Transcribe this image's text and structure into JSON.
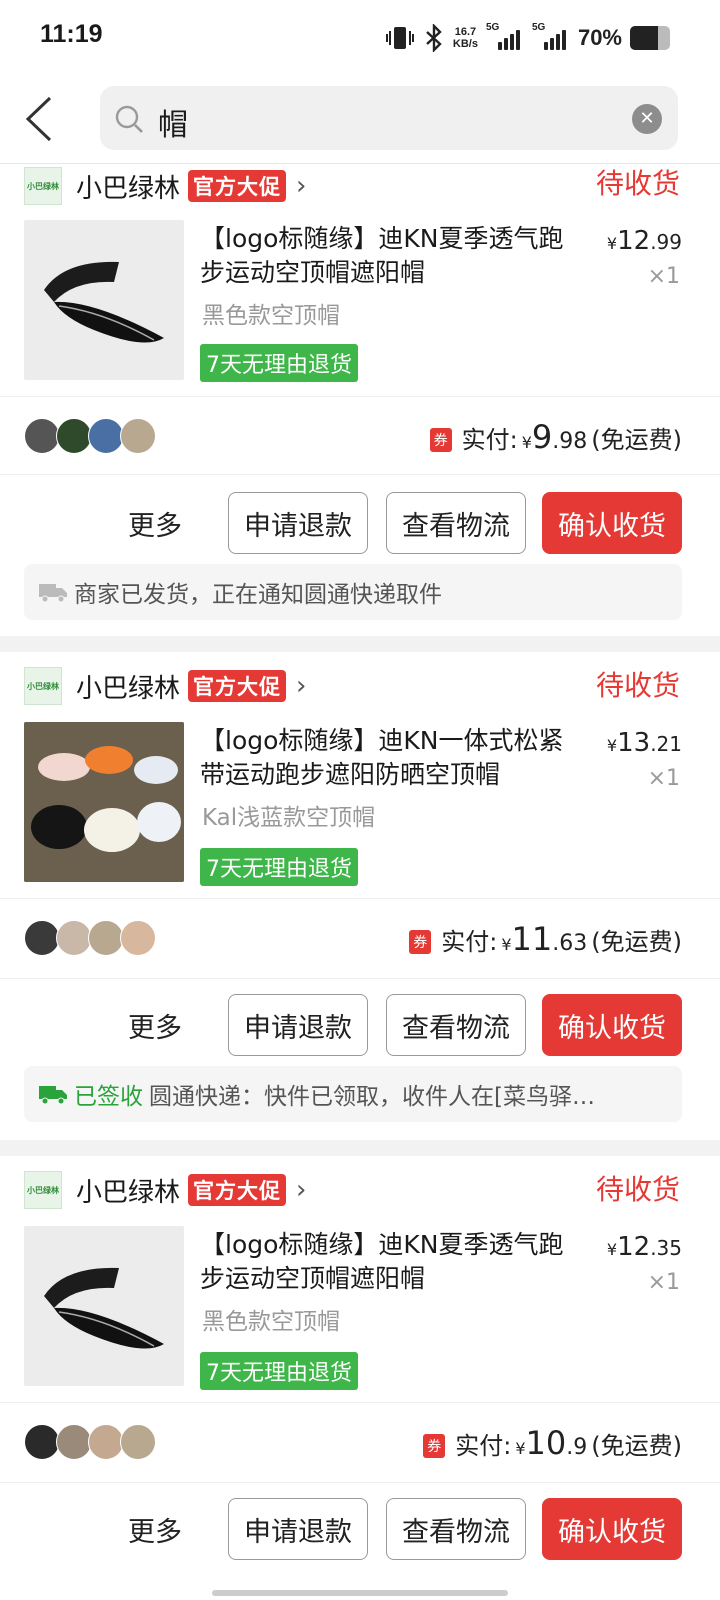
{
  "status_bar": {
    "time": "11:19",
    "net_speed": "16.7",
    "net_unit": "KB/s",
    "sim1": "5G",
    "sim2": "5G",
    "battery": "70%",
    "battery_level": 0.7,
    "icons": [
      "vibrate-icon",
      "bluetooth-icon",
      "signal-icon",
      "battery-icon"
    ]
  },
  "header": {
    "search_value": "帽"
  },
  "orders": [
    {
      "shop_name": "小巴绿林",
      "promo": "官方大促",
      "status": "待收货",
      "title": "【logo标随缘】迪KN夏季透气跑步运动空顶帽遮阳帽",
      "variant": "黑色款空顶帽",
      "return_tag": "7天无理由退货",
      "price_int": "12",
      "price_dec": ".99",
      "qty": "×1",
      "coupon": "券",
      "paid_label": "实付:",
      "paid_int": "9",
      "paid_dec": ".98",
      "shipping": "(免运费)",
      "more": "更多",
      "refund": "申请退款",
      "logistics": "查看物流",
      "confirm": "确认收货",
      "notice_signed": "",
      "notice": "商家已发货，正在通知圆通快递取件"
    },
    {
      "shop_name": "小巴绿林",
      "promo": "官方大促",
      "status": "待收货",
      "title": "【logo标随缘】迪KN一体式松紧带运动跑步遮阳防晒空顶帽",
      "variant": "Kal浅蓝款空顶帽",
      "return_tag": "7天无理由退货",
      "price_int": "13",
      "price_dec": ".21",
      "qty": "×1",
      "coupon": "券",
      "paid_label": "实付:",
      "paid_int": "11",
      "paid_dec": ".63",
      "shipping": "(免运费)",
      "more": "更多",
      "refund": "申请退款",
      "logistics": "查看物流",
      "confirm": "确认收货",
      "notice_signed": "已签收",
      "notice": "圆通快递：快件已领取，收件人在[菜鸟驿…"
    },
    {
      "shop_name": "小巴绿林",
      "promo": "官方大促",
      "status": "待收货",
      "title": "【logo标随缘】迪KN夏季透气跑步运动空顶帽遮阳帽",
      "variant": "黑色款空顶帽",
      "return_tag": "7天无理由退货",
      "price_int": "12",
      "price_dec": ".35",
      "qty": "×1",
      "coupon": "券",
      "paid_label": "实付:",
      "paid_int": "10",
      "paid_dec": ".9",
      "shipping": "(免运费)",
      "more": "更多",
      "refund": "申请退款",
      "logistics": "查看物流",
      "confirm": "确认收货"
    }
  ],
  "colors": {
    "accent_red": "#e53935",
    "green": "#3fb64a"
  }
}
